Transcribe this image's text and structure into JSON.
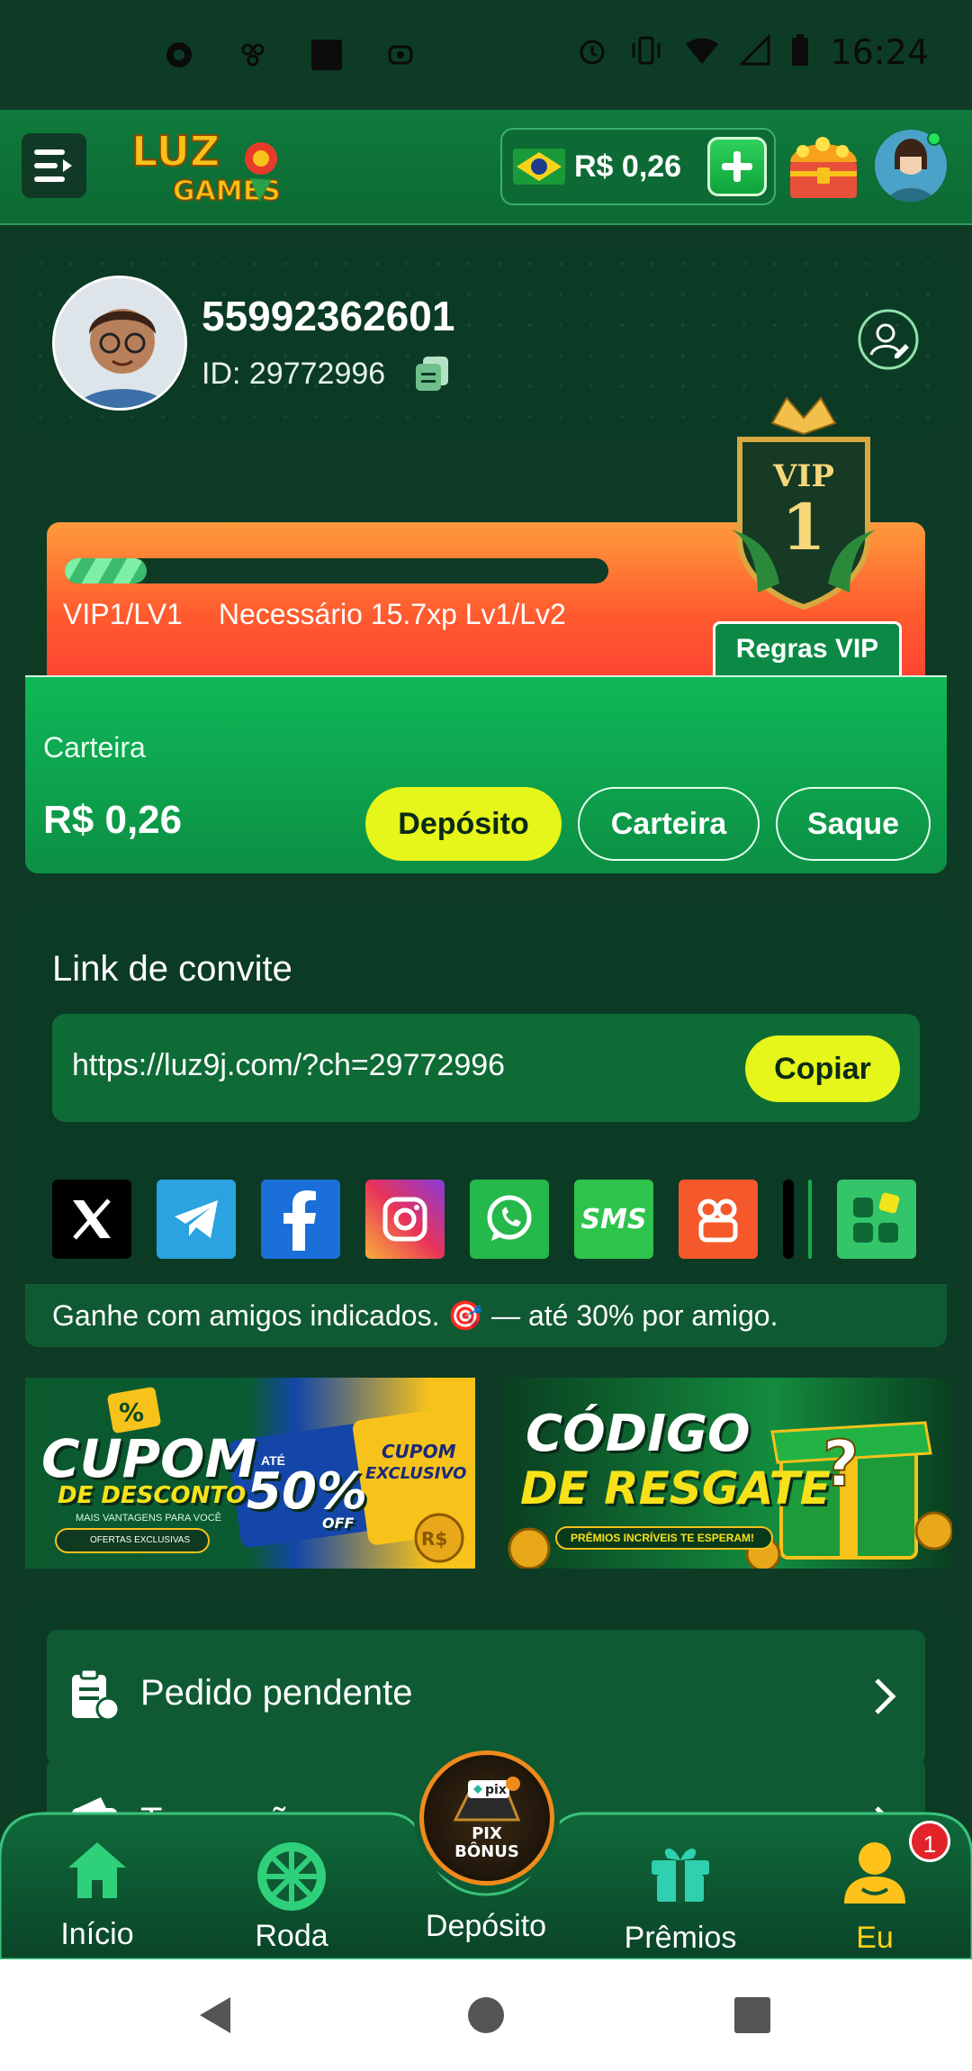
{
  "status_bar": {
    "time": "16:24"
  },
  "header": {
    "logo_text": "LUZ GAMES",
    "balance": "R$ 0,26"
  },
  "profile": {
    "username": "55992362601",
    "id_label": "ID: 29772996"
  },
  "vip": {
    "badge_label": "VIP",
    "badge_level": "1",
    "level_text": "VIP1/LV1",
    "requirement_text": "Necessário 15.7xp Lv1/Lv2",
    "progress": 0.15,
    "rules_button": "Regras VIP"
  },
  "wallet": {
    "label": "Carteira",
    "amount": "R$ 0,26",
    "deposit_button": "Depósito",
    "wallet_button": "Carteira",
    "withdraw_button": "Saque"
  },
  "invite": {
    "title": "Link de convite",
    "link": "https://luz9j.com/?ch=29772996",
    "copy_button": "Copiar",
    "share": [
      "x-icon",
      "telegram-icon",
      "facebook-icon",
      "instagram-icon",
      "whatsapp-icon",
      "sms-icon",
      "kwai-icon",
      "tiktok-icon",
      "more-apps-icon"
    ],
    "sms_label": "SMS",
    "footer_text": "Ganhe com amigos indicados. 🎯 — até 30% por amigo."
  },
  "banners": {
    "coupon": {
      "title1": "CUPOM",
      "title2": "DE DESCONTO",
      "percent": "50%",
      "off": "OFF",
      "ate": "ATÉ",
      "tag1": "CUPOM",
      "tag2": "EXCLUSIVO",
      "subtitle": "MAIS VANTAGENS PARA VOCÊ",
      "small": "OFERTAS EXCLUSIVAS"
    },
    "redeem": {
      "title1": "CÓDIGO",
      "title2": "DE RESGATE",
      "subtitle": "PRÊMIOS INCRÍVEIS TE ESPERAM!"
    }
  },
  "menu": {
    "items": [
      {
        "label": "Pedido pendente"
      },
      {
        "label": "Transação"
      }
    ]
  },
  "bottom_nav": {
    "items": [
      {
        "label": "Início"
      },
      {
        "label": "Roda"
      },
      {
        "label": "Depósito"
      },
      {
        "label": "Prêmios"
      },
      {
        "label": "Eu"
      }
    ],
    "pix_text": "pix",
    "pix_label": "PIX BÔNUS",
    "badge_count": "1"
  },
  "colors": {
    "background": "#0d3b26",
    "accent_yellow": "#e6f51a",
    "vip_orange": "#ff5b2e",
    "active_nav": "#ffd21a"
  }
}
